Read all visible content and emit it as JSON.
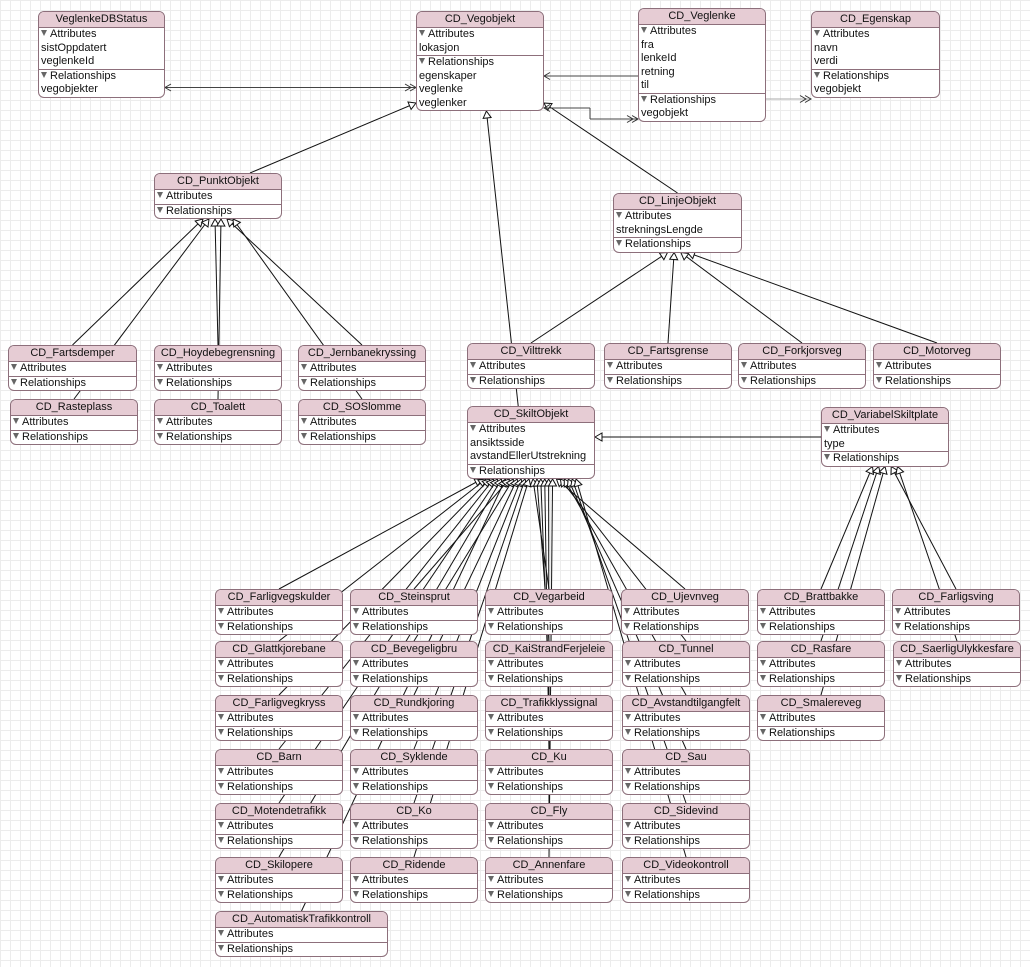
{
  "diagram": {
    "section_labels": {
      "attributes": "Attributes",
      "relationships": "Relationships"
    },
    "entities": [
      {
        "id": "VeglenkeDBStatus",
        "name": "VeglenkeDBStatus",
        "attributes": [
          "sistOppdatert",
          "veglenkeId"
        ],
        "relationships": [
          "vegobjekter"
        ]
      },
      {
        "id": "CD_Vegobjekt",
        "name": "CD_Vegobjekt",
        "attributes": [
          "lokasjon"
        ],
        "relationships": [
          "egenskaper",
          "veglenke",
          "veglenker"
        ]
      },
      {
        "id": "CD_Veglenke",
        "name": "CD_Veglenke",
        "attributes": [
          "fra",
          "lenkeId",
          "retning",
          "til"
        ],
        "relationships": [
          "vegobjekt"
        ]
      },
      {
        "id": "CD_Egenskap",
        "name": "CD_Egenskap",
        "attributes": [
          "navn",
          "verdi"
        ],
        "relationships": [
          "vegobjekt"
        ]
      },
      {
        "id": "CD_PunktObjekt",
        "name": "CD_PunktObjekt",
        "attributes": [],
        "relationships": []
      },
      {
        "id": "CD_LinjeObjekt",
        "name": "CD_LinjeObjekt",
        "attributes": [
          "strekningsLengde"
        ],
        "relationships": []
      },
      {
        "id": "CD_Fartsdemper",
        "name": "CD_Fartsdemper",
        "attributes": [],
        "relationships": []
      },
      {
        "id": "CD_Hoydebegrensning",
        "name": "CD_Hoydebegrensning",
        "attributes": [],
        "relationships": []
      },
      {
        "id": "CD_Jernbanekryssing",
        "name": "CD_Jernbanekryssing",
        "attributes": [],
        "relationships": []
      },
      {
        "id": "CD_Rasteplass",
        "name": "CD_Rasteplass",
        "attributes": [],
        "relationships": []
      },
      {
        "id": "CD_Toalett",
        "name": "CD_Toalett",
        "attributes": [],
        "relationships": []
      },
      {
        "id": "CD_SOSlomme",
        "name": "CD_SOSlomme",
        "attributes": [],
        "relationships": []
      },
      {
        "id": "CD_Vilttrekk",
        "name": "CD_Vilttrekk",
        "attributes": [],
        "relationships": []
      },
      {
        "id": "CD_Fartsgrense",
        "name": "CD_Fartsgrense",
        "attributes": [],
        "relationships": []
      },
      {
        "id": "CD_Forkjorsveg",
        "name": "CD_Forkjorsveg",
        "attributes": [],
        "relationships": []
      },
      {
        "id": "CD_Motorveg",
        "name": "CD_Motorveg",
        "attributes": [],
        "relationships": []
      },
      {
        "id": "CD_SkiltObjekt",
        "name": "CD_SkiltObjekt",
        "attributes": [
          "ansiktsside",
          "avstandEllerUtstrekning"
        ],
        "relationships": []
      },
      {
        "id": "CD_VariabelSkiltplate",
        "name": "CD_VariabelSkiltplate",
        "attributes": [
          "type"
        ],
        "relationships": []
      },
      {
        "id": "CD_Farligvegskulder",
        "name": "CD_Farligvegskulder",
        "attributes": [],
        "relationships": []
      },
      {
        "id": "CD_Steinsprut",
        "name": "CD_Steinsprut",
        "attributes": [],
        "relationships": []
      },
      {
        "id": "CD_Vegarbeid",
        "name": "CD_Vegarbeid",
        "attributes": [],
        "relationships": []
      },
      {
        "id": "CD_Ujevnveg",
        "name": "CD_Ujevnveg",
        "attributes": [],
        "relationships": []
      },
      {
        "id": "CD_Brattbakke",
        "name": "CD_Brattbakke",
        "attributes": [],
        "relationships": []
      },
      {
        "id": "CD_Farligsving",
        "name": "CD_Farligsving",
        "attributes": [],
        "relationships": []
      },
      {
        "id": "CD_Glattkjorebane",
        "name": "CD_Glattkjorebane",
        "attributes": [],
        "relationships": []
      },
      {
        "id": "CD_Bevegeligbru",
        "name": "CD_Bevegeligbru",
        "attributes": [],
        "relationships": []
      },
      {
        "id": "CD_KaiStrandFerjeleie",
        "name": "CD_KaiStrandFerjeleie",
        "attributes": [],
        "relationships": []
      },
      {
        "id": "CD_Tunnel",
        "name": "CD_Tunnel",
        "attributes": [],
        "relationships": []
      },
      {
        "id": "CD_Rasfare",
        "name": "CD_Rasfare",
        "attributes": [],
        "relationships": []
      },
      {
        "id": "CD_SaerligUlykkesfare",
        "name": "CD_SaerligUlykkesfare",
        "attributes": [],
        "relationships": []
      },
      {
        "id": "CD_Farligvegkryss",
        "name": "CD_Farligvegkryss",
        "attributes": [],
        "relationships": []
      },
      {
        "id": "CD_Rundkjoring",
        "name": "CD_Rundkjoring",
        "attributes": [],
        "relationships": []
      },
      {
        "id": "CD_Trafikklyssignal",
        "name": "CD_Trafikklyssignal",
        "attributes": [],
        "relationships": []
      },
      {
        "id": "CD_Avstandtilgangfelt",
        "name": "CD_Avstandtilgangfelt",
        "attributes": [],
        "relationships": []
      },
      {
        "id": "CD_Smalereveg",
        "name": "CD_Smalereveg",
        "attributes": [],
        "relationships": []
      },
      {
        "id": "CD_Barn",
        "name": "CD_Barn",
        "attributes": [],
        "relationships": []
      },
      {
        "id": "CD_Syklende",
        "name": "CD_Syklende",
        "attributes": [],
        "relationships": []
      },
      {
        "id": "CD_Ku",
        "name": "CD_Ku",
        "attributes": [],
        "relationships": []
      },
      {
        "id": "CD_Sau",
        "name": "CD_Sau",
        "attributes": [],
        "relationships": []
      },
      {
        "id": "CD_Motendetrafikk",
        "name": "CD_Motendetrafikk",
        "attributes": [],
        "relationships": []
      },
      {
        "id": "CD_Ko",
        "name": "CD_Ko",
        "attributes": [],
        "relationships": []
      },
      {
        "id": "CD_Fly",
        "name": "CD_Fly",
        "attributes": [],
        "relationships": []
      },
      {
        "id": "CD_Sidevind",
        "name": "CD_Sidevind",
        "attributes": [],
        "relationships": []
      },
      {
        "id": "CD_Skilopere",
        "name": "CD_Skilopere",
        "attributes": [],
        "relationships": []
      },
      {
        "id": "CD_Ridende",
        "name": "CD_Ridende",
        "attributes": [],
        "relationships": []
      },
      {
        "id": "CD_Annenfare",
        "name": "CD_Annenfare",
        "attributes": [],
        "relationships": []
      },
      {
        "id": "CD_Videokontroll",
        "name": "CD_Videokontroll",
        "attributes": [],
        "relationships": []
      },
      {
        "id": "CD_AutomatiskTrafikkontroll",
        "name": "CD_AutomatiskTrafikkontroll",
        "attributes": [],
        "relationships": []
      }
    ],
    "inheritance": [
      {
        "child": "CD_PunktObjekt",
        "parent": "CD_Vegobjekt"
      },
      {
        "child": "CD_LinjeObjekt",
        "parent": "CD_Vegobjekt"
      },
      {
        "child": "CD_SkiltObjekt",
        "parent": "CD_Vegobjekt"
      },
      {
        "child": "CD_Fartsdemper",
        "parent": "CD_PunktObjekt"
      },
      {
        "child": "CD_Rasteplass",
        "parent": "CD_PunktObjekt"
      },
      {
        "child": "CD_Hoydebegrensning",
        "parent": "CD_PunktObjekt"
      },
      {
        "child": "CD_Toalett",
        "parent": "CD_PunktObjekt"
      },
      {
        "child": "CD_Jernbanekryssing",
        "parent": "CD_PunktObjekt"
      },
      {
        "child": "CD_SOSlomme",
        "parent": "CD_PunktObjekt"
      },
      {
        "child": "CD_Vilttrekk",
        "parent": "CD_LinjeObjekt"
      },
      {
        "child": "CD_Fartsgrense",
        "parent": "CD_LinjeObjekt"
      },
      {
        "child": "CD_Forkjorsveg",
        "parent": "CD_LinjeObjekt"
      },
      {
        "child": "CD_Motorveg",
        "parent": "CD_LinjeObjekt"
      },
      {
        "child": "CD_VariabelSkiltplate",
        "parent": "CD_SkiltObjekt"
      },
      {
        "child": "CD_Farligvegskulder",
        "parent": "CD_SkiltObjekt"
      },
      {
        "child": "CD_Steinsprut",
        "parent": "CD_SkiltObjekt"
      },
      {
        "child": "CD_Vegarbeid",
        "parent": "CD_SkiltObjekt"
      },
      {
        "child": "CD_Ujevnveg",
        "parent": "CD_SkiltObjekt"
      },
      {
        "child": "CD_Glattkjorebane",
        "parent": "CD_SkiltObjekt"
      },
      {
        "child": "CD_Bevegeligbru",
        "parent": "CD_SkiltObjekt"
      },
      {
        "child": "CD_KaiStrandFerjeleie",
        "parent": "CD_SkiltObjekt"
      },
      {
        "child": "CD_Tunnel",
        "parent": "CD_SkiltObjekt"
      },
      {
        "child": "CD_Farligvegkryss",
        "parent": "CD_SkiltObjekt"
      },
      {
        "child": "CD_Rundkjoring",
        "parent": "CD_SkiltObjekt"
      },
      {
        "child": "CD_Trafikklyssignal",
        "parent": "CD_SkiltObjekt"
      },
      {
        "child": "CD_Avstandtilgangfelt",
        "parent": "CD_SkiltObjekt"
      },
      {
        "child": "CD_Barn",
        "parent": "CD_SkiltObjekt"
      },
      {
        "child": "CD_Syklende",
        "parent": "CD_SkiltObjekt"
      },
      {
        "child": "CD_Ku",
        "parent": "CD_SkiltObjekt"
      },
      {
        "child": "CD_Sau",
        "parent": "CD_SkiltObjekt"
      },
      {
        "child": "CD_Motendetrafikk",
        "parent": "CD_SkiltObjekt"
      },
      {
        "child": "CD_Ko",
        "parent": "CD_SkiltObjekt"
      },
      {
        "child": "CD_Fly",
        "parent": "CD_SkiltObjekt"
      },
      {
        "child": "CD_Sidevind",
        "parent": "CD_SkiltObjekt"
      },
      {
        "child": "CD_Skilopere",
        "parent": "CD_SkiltObjekt"
      },
      {
        "child": "CD_Ridende",
        "parent": "CD_SkiltObjekt"
      },
      {
        "child": "CD_Annenfare",
        "parent": "CD_SkiltObjekt"
      },
      {
        "child": "CD_Videokontroll",
        "parent": "CD_SkiltObjekt"
      },
      {
        "child": "CD_AutomatiskTrafikkontroll",
        "parent": "CD_SkiltObjekt"
      },
      {
        "child": "CD_Brattbakke",
        "parent": "CD_VariabelSkiltplate"
      },
      {
        "child": "CD_Rasfare",
        "parent": "CD_VariabelSkiltplate"
      },
      {
        "child": "CD_Smalereveg",
        "parent": "CD_VariabelSkiltplate"
      },
      {
        "child": "CD_Farligsving",
        "parent": "CD_VariabelSkiltplate"
      },
      {
        "child": "CD_SaerligUlykkesfare",
        "parent": "CD_VariabelSkiltplate"
      }
    ],
    "relations": [
      {
        "from": "VeglenkeDBStatus",
        "from_attr": "vegobjekter",
        "to": "CD_Vegobjekt",
        "to_attr": "veglenke"
      },
      {
        "from": "CD_Vegobjekt",
        "from_attr": "egenskaper",
        "to": "CD_Egenskap",
        "to_attr": "vegobjekt"
      },
      {
        "from": "CD_Vegobjekt",
        "from_attr": "veglenker",
        "to": "CD_Veglenke",
        "to_attr": "vegobjekt"
      }
    ]
  }
}
